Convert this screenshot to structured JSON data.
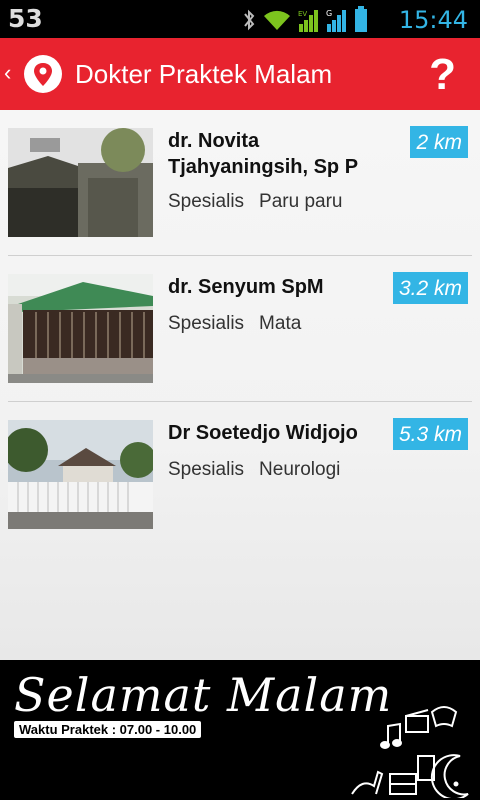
{
  "status_bar": {
    "notification_count": "53",
    "time": "15:44",
    "icons": [
      "bluetooth-icon",
      "wifi-icon",
      "signal-ev-icon",
      "signal-g-icon",
      "battery-icon"
    ]
  },
  "action_bar": {
    "title": "Dokter Praktek Malam",
    "help_label": "?",
    "back_glyph": "‹",
    "colors": {
      "background": "#e8232f",
      "accent": "#33b5e5"
    }
  },
  "doctors": [
    {
      "name": "dr. Novita Tjahyaningsih, Sp P",
      "distance": "2 km",
      "spec_label": "Spesialis",
      "specialty": "Paru paru"
    },
    {
      "name": "dr. Senyum SpM",
      "distance": "3.2 km",
      "spec_label": "Spesialis",
      "specialty": "Mata"
    },
    {
      "name": "Dr Soetedjo Widjojo",
      "distance": "5.3 km",
      "spec_label": "Spesialis",
      "specialty": "Neurologi"
    }
  ],
  "banner": {
    "greeting": "Selamat Malam",
    "hours": "Waktu Praktek : 07.00 - 10.00"
  }
}
